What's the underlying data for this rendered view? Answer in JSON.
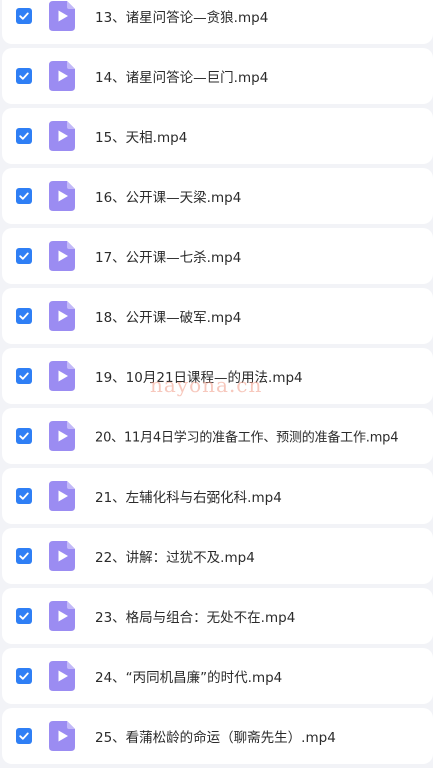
{
  "files": [
    {
      "name": "13、诸星问答论—贪狼.mp4"
    },
    {
      "name": "14、诸星问答论—巨门.mp4"
    },
    {
      "name": "15、天相.mp4"
    },
    {
      "name": "16、公开课—天梁.mp4"
    },
    {
      "name": "17、公开课—七杀.mp4"
    },
    {
      "name": "18、公开课—破军.mp4"
    },
    {
      "name": "19、10月21日课程—的用法.mp4"
    },
    {
      "name": "20、11月4日学习的准备工作、预测的准备工作.mp4"
    },
    {
      "name": "21、左辅化科与右弼化科.mp4"
    },
    {
      "name": "22、讲解：过犹不及.mp4"
    },
    {
      "name": "23、格局与组合：无处不在.mp4"
    },
    {
      "name": "24、“丙同机昌廉”的时代.mp4"
    },
    {
      "name": "25、看蒲松龄的命运（聊斋先生）.mp4"
    }
  ],
  "watermark": "nayona.cn",
  "colors": {
    "checkbox": "#2f7ff5",
    "file_icon": "#9b8cf2",
    "row_bg": "#ffffff",
    "page_bg": "#f2f3f7"
  },
  "icons": {
    "checkbox": "checkmark-icon",
    "file": "video-file-icon"
  }
}
